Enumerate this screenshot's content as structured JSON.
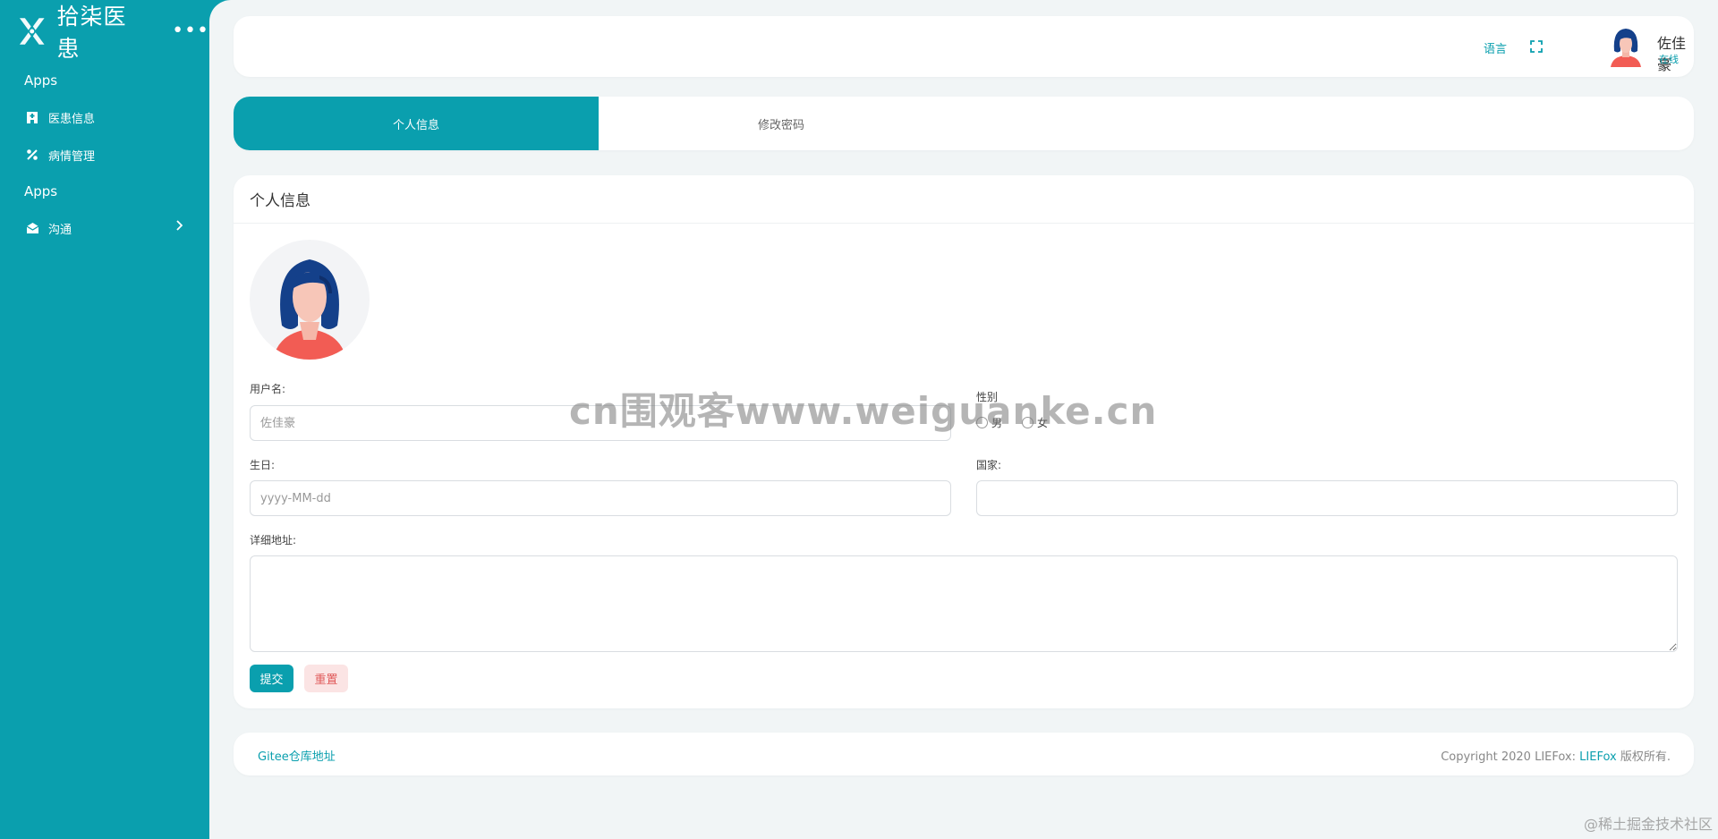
{
  "sidebar": {
    "brand": "拾柒医患",
    "more": "•••",
    "sections": [
      {
        "title": "Apps",
        "items": [
          {
            "label": "医患信息",
            "icon": "hospital-icon"
          },
          {
            "label": "病情管理",
            "icon": "percent-icon"
          }
        ]
      },
      {
        "title": "Apps",
        "items": [
          {
            "label": "沟通",
            "icon": "envelope-open-icon"
          }
        ]
      }
    ]
  },
  "topbar": {
    "language": "语言",
    "username": "佐佳豪",
    "status": "在线"
  },
  "tabs": [
    "个人信息",
    "修改密码"
  ],
  "form": {
    "title": "个人信息",
    "username_label": "用户名:",
    "username_placeholder": "佐佳豪",
    "gender_label": "性别",
    "gender_male": "男",
    "gender_female": "女",
    "birthday_label": "生日:",
    "birthday_placeholder": "yyyy-MM-dd",
    "country_label": "国家:",
    "address_label": "详细地址:",
    "submit": "提交",
    "reset": "重置"
  },
  "footer": {
    "repo_link": "Gitee仓库地址",
    "copyright_prefix": "Copyright 2020 LIEFox:",
    "copyright_link": "LIEFox",
    "copyright_suffix": "版权所有."
  },
  "watermarks": {
    "center": "cn围观客www.weiguanke.cn",
    "corner": "@稀土掘金技术社区"
  },
  "colors": {
    "primary": "#0a9fae",
    "background": "#f1f5f6",
    "reset_bg": "#fbe4e4",
    "reset_text": "#e05a5a"
  }
}
